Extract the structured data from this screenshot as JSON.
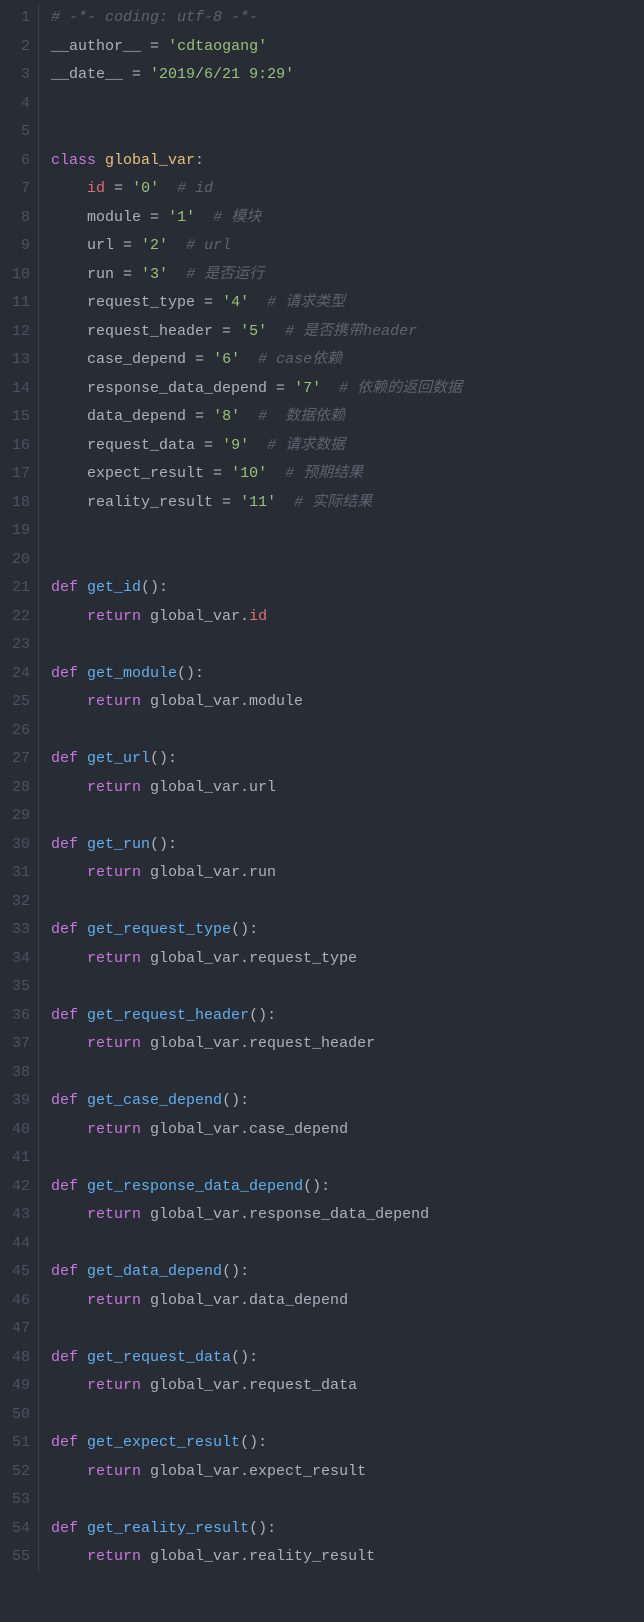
{
  "lines": {
    "1": [
      {
        "cls": "tok-comment",
        "t": "# -*- coding: utf-8 -*-"
      }
    ],
    "2": [
      {
        "cls": "tok-plain",
        "t": "__author__ "
      },
      {
        "cls": "tok-op",
        "t": "="
      },
      {
        "cls": "tok-plain",
        "t": " "
      },
      {
        "cls": "tok-string",
        "t": "'cdtaogang'"
      }
    ],
    "3": [
      {
        "cls": "tok-plain",
        "t": "__date__ "
      },
      {
        "cls": "tok-op",
        "t": "="
      },
      {
        "cls": "tok-plain",
        "t": " "
      },
      {
        "cls": "tok-string",
        "t": "'2019/6/21 9:29'"
      }
    ],
    "4": [
      {
        "cls": "tok-plain",
        "t": ""
      }
    ],
    "5": [
      {
        "cls": "tok-plain",
        "t": ""
      }
    ],
    "6": [
      {
        "cls": "tok-keyword",
        "t": "class"
      },
      {
        "cls": "tok-plain",
        "t": " "
      },
      {
        "cls": "tok-class",
        "t": "global_var"
      },
      {
        "cls": "tok-punct",
        "t": ":"
      }
    ],
    "7": [
      {
        "cls": "tok-plain",
        "t": "    "
      },
      {
        "cls": "tok-attr",
        "t": "id"
      },
      {
        "cls": "tok-plain",
        "t": " "
      },
      {
        "cls": "tok-op",
        "t": "="
      },
      {
        "cls": "tok-plain",
        "t": " "
      },
      {
        "cls": "tok-string",
        "t": "'0'"
      },
      {
        "cls": "tok-plain",
        "t": "  "
      },
      {
        "cls": "tok-comment",
        "t": "# id"
      }
    ],
    "8": [
      {
        "cls": "tok-plain",
        "t": "    module "
      },
      {
        "cls": "tok-op",
        "t": "="
      },
      {
        "cls": "tok-plain",
        "t": " "
      },
      {
        "cls": "tok-string",
        "t": "'1'"
      },
      {
        "cls": "tok-plain",
        "t": "  "
      },
      {
        "cls": "tok-comment",
        "t": "# 模块"
      }
    ],
    "9": [
      {
        "cls": "tok-plain",
        "t": "    url "
      },
      {
        "cls": "tok-op",
        "t": "="
      },
      {
        "cls": "tok-plain",
        "t": " "
      },
      {
        "cls": "tok-string",
        "t": "'2'"
      },
      {
        "cls": "tok-plain",
        "t": "  "
      },
      {
        "cls": "tok-comment",
        "t": "# url"
      }
    ],
    "10": [
      {
        "cls": "tok-plain",
        "t": "    run "
      },
      {
        "cls": "tok-op",
        "t": "="
      },
      {
        "cls": "tok-plain",
        "t": " "
      },
      {
        "cls": "tok-string",
        "t": "'3'"
      },
      {
        "cls": "tok-plain",
        "t": "  "
      },
      {
        "cls": "tok-comment",
        "t": "# 是否运行"
      }
    ],
    "11": [
      {
        "cls": "tok-plain",
        "t": "    request_type "
      },
      {
        "cls": "tok-op",
        "t": "="
      },
      {
        "cls": "tok-plain",
        "t": " "
      },
      {
        "cls": "tok-string",
        "t": "'4'"
      },
      {
        "cls": "tok-plain",
        "t": "  "
      },
      {
        "cls": "tok-comment",
        "t": "# 请求类型"
      }
    ],
    "12": [
      {
        "cls": "tok-plain",
        "t": "    request_header "
      },
      {
        "cls": "tok-op",
        "t": "="
      },
      {
        "cls": "tok-plain",
        "t": " "
      },
      {
        "cls": "tok-string",
        "t": "'5'"
      },
      {
        "cls": "tok-plain",
        "t": "  "
      },
      {
        "cls": "tok-comment",
        "t": "# 是否携带header"
      }
    ],
    "13": [
      {
        "cls": "tok-plain",
        "t": "    case_depend "
      },
      {
        "cls": "tok-op",
        "t": "="
      },
      {
        "cls": "tok-plain",
        "t": " "
      },
      {
        "cls": "tok-string",
        "t": "'6'"
      },
      {
        "cls": "tok-plain",
        "t": "  "
      },
      {
        "cls": "tok-comment",
        "t": "# case依赖"
      }
    ],
    "14": [
      {
        "cls": "tok-plain",
        "t": "    response_data_depend "
      },
      {
        "cls": "tok-op",
        "t": "="
      },
      {
        "cls": "tok-plain",
        "t": " "
      },
      {
        "cls": "tok-string",
        "t": "'7'"
      },
      {
        "cls": "tok-plain",
        "t": "  "
      },
      {
        "cls": "tok-comment",
        "t": "# 依赖的返回数据"
      }
    ],
    "15": [
      {
        "cls": "tok-plain",
        "t": "    data_depend "
      },
      {
        "cls": "tok-op",
        "t": "="
      },
      {
        "cls": "tok-plain",
        "t": " "
      },
      {
        "cls": "tok-string",
        "t": "'8'"
      },
      {
        "cls": "tok-plain",
        "t": "  "
      },
      {
        "cls": "tok-comment",
        "t": "#  数据依赖"
      }
    ],
    "16": [
      {
        "cls": "tok-plain",
        "t": "    request_data "
      },
      {
        "cls": "tok-op",
        "t": "="
      },
      {
        "cls": "tok-plain",
        "t": " "
      },
      {
        "cls": "tok-string",
        "t": "'9'"
      },
      {
        "cls": "tok-plain",
        "t": "  "
      },
      {
        "cls": "tok-comment",
        "t": "# 请求数据"
      }
    ],
    "17": [
      {
        "cls": "tok-plain",
        "t": "    expect_result "
      },
      {
        "cls": "tok-op",
        "t": "="
      },
      {
        "cls": "tok-plain",
        "t": " "
      },
      {
        "cls": "tok-string",
        "t": "'10'"
      },
      {
        "cls": "tok-plain",
        "t": "  "
      },
      {
        "cls": "tok-comment",
        "t": "# 预期结果"
      }
    ],
    "18": [
      {
        "cls": "tok-plain",
        "t": "    reality_result "
      },
      {
        "cls": "tok-op",
        "t": "="
      },
      {
        "cls": "tok-plain",
        "t": " "
      },
      {
        "cls": "tok-string",
        "t": "'11'"
      },
      {
        "cls": "tok-plain",
        "t": "  "
      },
      {
        "cls": "tok-comment",
        "t": "# 实际结果"
      }
    ],
    "19": [
      {
        "cls": "tok-plain",
        "t": ""
      }
    ],
    "20": [
      {
        "cls": "tok-plain",
        "t": ""
      }
    ],
    "21": [
      {
        "cls": "tok-keyword",
        "t": "def"
      },
      {
        "cls": "tok-plain",
        "t": " "
      },
      {
        "cls": "tok-func",
        "t": "get_id"
      },
      {
        "cls": "tok-punct",
        "t": "():"
      }
    ],
    "22": [
      {
        "cls": "tok-plain",
        "t": "    "
      },
      {
        "cls": "tok-keyword",
        "t": "return"
      },
      {
        "cls": "tok-plain",
        "t": " global_var."
      },
      {
        "cls": "tok-attr",
        "t": "id"
      }
    ],
    "23": [
      {
        "cls": "tok-plain",
        "t": ""
      }
    ],
    "24": [
      {
        "cls": "tok-keyword",
        "t": "def"
      },
      {
        "cls": "tok-plain",
        "t": " "
      },
      {
        "cls": "tok-func",
        "t": "get_module"
      },
      {
        "cls": "tok-punct",
        "t": "():"
      }
    ],
    "25": [
      {
        "cls": "tok-plain",
        "t": "    "
      },
      {
        "cls": "tok-keyword",
        "t": "return"
      },
      {
        "cls": "tok-plain",
        "t": " global_var.module"
      }
    ],
    "26": [
      {
        "cls": "tok-plain",
        "t": ""
      }
    ],
    "27": [
      {
        "cls": "tok-keyword",
        "t": "def"
      },
      {
        "cls": "tok-plain",
        "t": " "
      },
      {
        "cls": "tok-func",
        "t": "get_url"
      },
      {
        "cls": "tok-punct",
        "t": "():"
      }
    ],
    "28": [
      {
        "cls": "tok-plain",
        "t": "    "
      },
      {
        "cls": "tok-keyword",
        "t": "return"
      },
      {
        "cls": "tok-plain",
        "t": " global_var.url"
      }
    ],
    "29": [
      {
        "cls": "tok-plain",
        "t": ""
      }
    ],
    "30": [
      {
        "cls": "tok-keyword",
        "t": "def"
      },
      {
        "cls": "tok-plain",
        "t": " "
      },
      {
        "cls": "tok-func",
        "t": "get_run"
      },
      {
        "cls": "tok-punct",
        "t": "():"
      }
    ],
    "31": [
      {
        "cls": "tok-plain",
        "t": "    "
      },
      {
        "cls": "tok-keyword",
        "t": "return"
      },
      {
        "cls": "tok-plain",
        "t": " global_var.run"
      }
    ],
    "32": [
      {
        "cls": "tok-plain",
        "t": ""
      }
    ],
    "33": [
      {
        "cls": "tok-keyword",
        "t": "def"
      },
      {
        "cls": "tok-plain",
        "t": " "
      },
      {
        "cls": "tok-func",
        "t": "get_request_type"
      },
      {
        "cls": "tok-punct",
        "t": "():"
      }
    ],
    "34": [
      {
        "cls": "tok-plain",
        "t": "    "
      },
      {
        "cls": "tok-keyword",
        "t": "return"
      },
      {
        "cls": "tok-plain",
        "t": " global_var.request_type"
      }
    ],
    "35": [
      {
        "cls": "tok-plain",
        "t": ""
      }
    ],
    "36": [
      {
        "cls": "tok-keyword",
        "t": "def"
      },
      {
        "cls": "tok-plain",
        "t": " "
      },
      {
        "cls": "tok-func",
        "t": "get_request_header"
      },
      {
        "cls": "tok-punct",
        "t": "():"
      }
    ],
    "37": [
      {
        "cls": "tok-plain",
        "t": "    "
      },
      {
        "cls": "tok-keyword",
        "t": "return"
      },
      {
        "cls": "tok-plain",
        "t": " global_var.request_header"
      }
    ],
    "38": [
      {
        "cls": "tok-plain",
        "t": ""
      }
    ],
    "39": [
      {
        "cls": "tok-keyword",
        "t": "def"
      },
      {
        "cls": "tok-plain",
        "t": " "
      },
      {
        "cls": "tok-func",
        "t": "get_case_depend"
      },
      {
        "cls": "tok-punct",
        "t": "():"
      }
    ],
    "40": [
      {
        "cls": "tok-plain",
        "t": "    "
      },
      {
        "cls": "tok-keyword",
        "t": "return"
      },
      {
        "cls": "tok-plain",
        "t": " global_var.case_depend"
      }
    ],
    "41": [
      {
        "cls": "tok-plain",
        "t": ""
      }
    ],
    "42": [
      {
        "cls": "tok-keyword",
        "t": "def"
      },
      {
        "cls": "tok-plain",
        "t": " "
      },
      {
        "cls": "tok-func",
        "t": "get_response_data_depend"
      },
      {
        "cls": "tok-punct",
        "t": "():"
      }
    ],
    "43": [
      {
        "cls": "tok-plain",
        "t": "    "
      },
      {
        "cls": "tok-keyword",
        "t": "return"
      },
      {
        "cls": "tok-plain",
        "t": " global_var.response_data_depend"
      }
    ],
    "44": [
      {
        "cls": "tok-plain",
        "t": ""
      }
    ],
    "45": [
      {
        "cls": "tok-keyword",
        "t": "def"
      },
      {
        "cls": "tok-plain",
        "t": " "
      },
      {
        "cls": "tok-func",
        "t": "get_data_depend"
      },
      {
        "cls": "tok-punct",
        "t": "():"
      }
    ],
    "46": [
      {
        "cls": "tok-plain",
        "t": "    "
      },
      {
        "cls": "tok-keyword",
        "t": "return"
      },
      {
        "cls": "tok-plain",
        "t": " global_var.data_depend"
      }
    ],
    "47": [
      {
        "cls": "tok-plain",
        "t": ""
      }
    ],
    "48": [
      {
        "cls": "tok-keyword",
        "t": "def"
      },
      {
        "cls": "tok-plain",
        "t": " "
      },
      {
        "cls": "tok-func",
        "t": "get_request_data"
      },
      {
        "cls": "tok-punct",
        "t": "():"
      }
    ],
    "49": [
      {
        "cls": "tok-plain",
        "t": "    "
      },
      {
        "cls": "tok-keyword",
        "t": "return"
      },
      {
        "cls": "tok-plain",
        "t": " global_var.request_data"
      }
    ],
    "50": [
      {
        "cls": "tok-plain",
        "t": ""
      }
    ],
    "51": [
      {
        "cls": "tok-keyword",
        "t": "def"
      },
      {
        "cls": "tok-plain",
        "t": " "
      },
      {
        "cls": "tok-func",
        "t": "get_expect_result"
      },
      {
        "cls": "tok-punct",
        "t": "():"
      }
    ],
    "52": [
      {
        "cls": "tok-plain",
        "t": "    "
      },
      {
        "cls": "tok-keyword",
        "t": "return"
      },
      {
        "cls": "tok-plain",
        "t": " global_var.expect_result"
      }
    ],
    "53": [
      {
        "cls": "tok-plain",
        "t": ""
      }
    ],
    "54": [
      {
        "cls": "tok-keyword",
        "t": "def"
      },
      {
        "cls": "tok-plain",
        "t": " "
      },
      {
        "cls": "tok-func",
        "t": "get_reality_result"
      },
      {
        "cls": "tok-punct",
        "t": "():"
      }
    ],
    "55": [
      {
        "cls": "tok-plain",
        "t": "    "
      },
      {
        "cls": "tok-keyword",
        "t": "return"
      },
      {
        "cls": "tok-plain",
        "t": " global_var.reality_result"
      }
    ]
  },
  "lineCount": 55
}
